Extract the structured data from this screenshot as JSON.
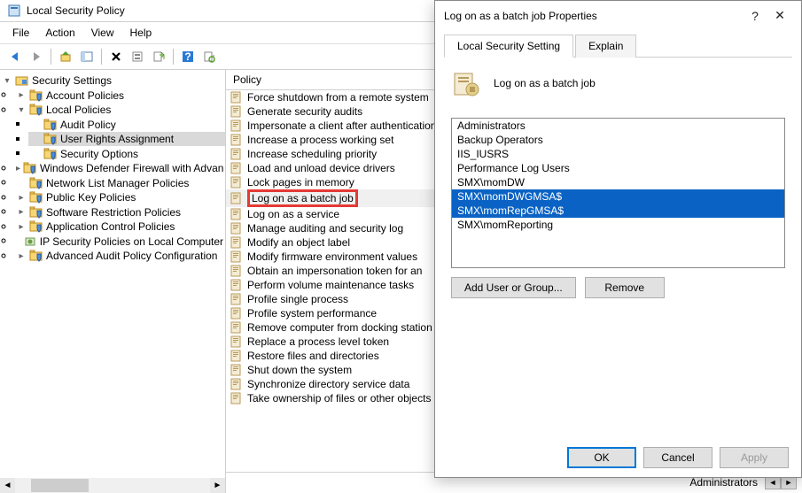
{
  "title": "Local Security Policy",
  "menubar": [
    "File",
    "Action",
    "View",
    "Help"
  ],
  "tree": {
    "root": "Security Settings",
    "items": [
      {
        "label": "Account Policies",
        "exp": ">"
      },
      {
        "label": "Local Policies",
        "exp": "v",
        "children": [
          {
            "label": "Audit Policy"
          },
          {
            "label": "User Rights Assignment",
            "selected": true
          },
          {
            "label": "Security Options"
          }
        ]
      },
      {
        "label": "Windows Defender Firewall with Advan",
        "exp": ">"
      },
      {
        "label": "Network List Manager Policies"
      },
      {
        "label": "Public Key Policies",
        "exp": ">"
      },
      {
        "label": "Software Restriction Policies",
        "exp": ">"
      },
      {
        "label": "Application Control Policies",
        "exp": ">"
      },
      {
        "label": "IP Security Policies on Local Computer"
      },
      {
        "label": "Advanced Audit Policy Configuration",
        "exp": ">"
      }
    ]
  },
  "list": {
    "header": "Policy",
    "items": [
      "Force shutdown from a remote system",
      "Generate security audits",
      "Impersonate a client after authentication",
      "Increase a process working set",
      "Increase scheduling priority",
      "Load and unload device drivers",
      "Lock pages in memory",
      "Log on as a batch job",
      "Log on as a service",
      "Manage auditing and security log",
      "Modify an object label",
      "Modify firmware environment values",
      "Obtain an impersonation token for an",
      "Perform volume maintenance tasks",
      "Profile single process",
      "Profile system performance",
      "Remove computer from docking station",
      "Replace a process level token",
      "Restore files and directories",
      "Shut down the system",
      "Synchronize directory service data",
      "Take ownership of files or other objects"
    ],
    "selected_index": 7,
    "highlighted_index": 7
  },
  "dialog": {
    "title": "Log on as a batch job Properties",
    "tabs": [
      "Local Security Setting",
      "Explain"
    ],
    "active_tab": 0,
    "header_label": "Log on as a batch job",
    "users": [
      {
        "name": "Administrators"
      },
      {
        "name": "Backup Operators"
      },
      {
        "name": "IIS_IUSRS"
      },
      {
        "name": "Performance Log Users"
      },
      {
        "name": "SMX\\momDW"
      },
      {
        "name": "SMX\\momDWGMSA$",
        "selected": true
      },
      {
        "name": "SMX\\momRepGMSA$",
        "selected": true
      },
      {
        "name": "SMX\\momReporting"
      }
    ],
    "buttons": {
      "add": "Add User or Group...",
      "remove": "Remove"
    },
    "footer": {
      "ok": "OK",
      "cancel": "Cancel",
      "apply": "Apply"
    }
  },
  "statusbar": {
    "text": "Administrators"
  }
}
